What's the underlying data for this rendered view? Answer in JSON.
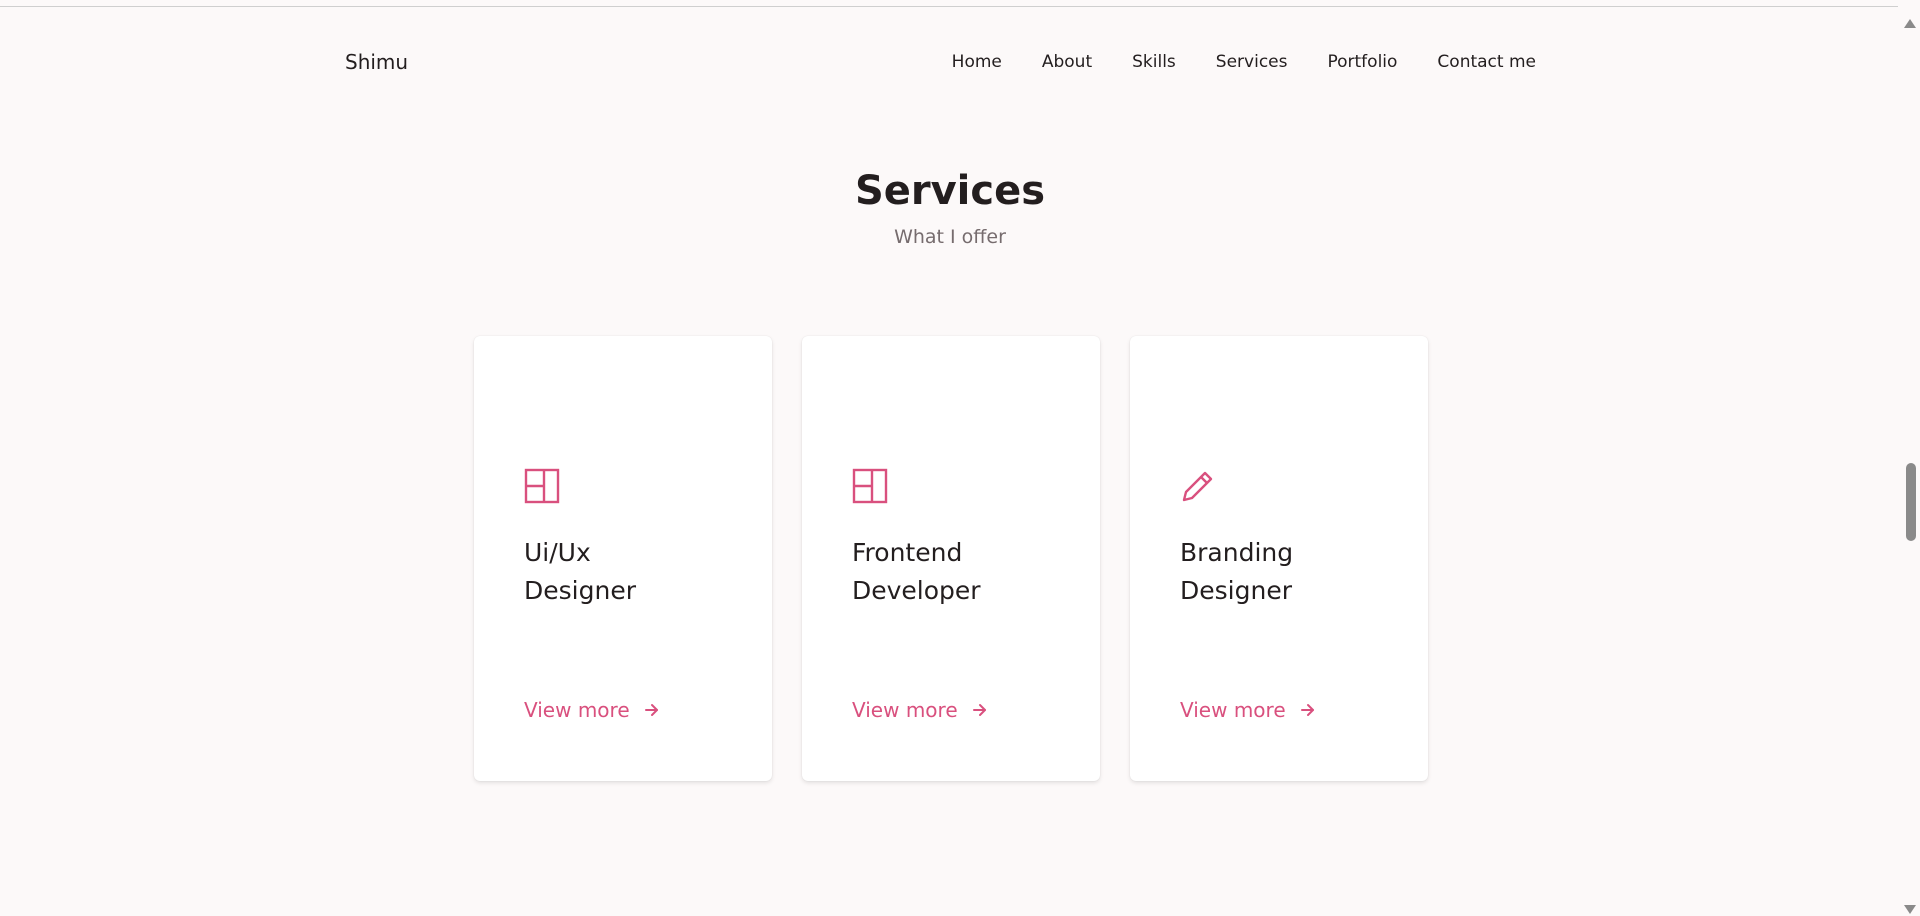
{
  "header": {
    "logo": "Shimu",
    "nav": [
      "Home",
      "About",
      "Skills",
      "Services",
      "Portfolio",
      "Contact me"
    ]
  },
  "services": {
    "title": "Services",
    "subtitle": "What I offer",
    "cards": [
      {
        "title_line1": "Ui/Ux",
        "title_line2": "Designer",
        "icon": "layout-icon",
        "link_label": "View more"
      },
      {
        "title_line1": "Frontend",
        "title_line2": "Developer",
        "icon": "layout-icon",
        "link_label": "View more"
      },
      {
        "title_line1": "Branding",
        "title_line2": "Designer",
        "icon": "pencil-icon",
        "link_label": "View more"
      }
    ]
  },
  "colors": {
    "accent": "#d9507e",
    "text": "#231e1f",
    "muted": "#766c6e",
    "background": "#fcf9f9"
  }
}
